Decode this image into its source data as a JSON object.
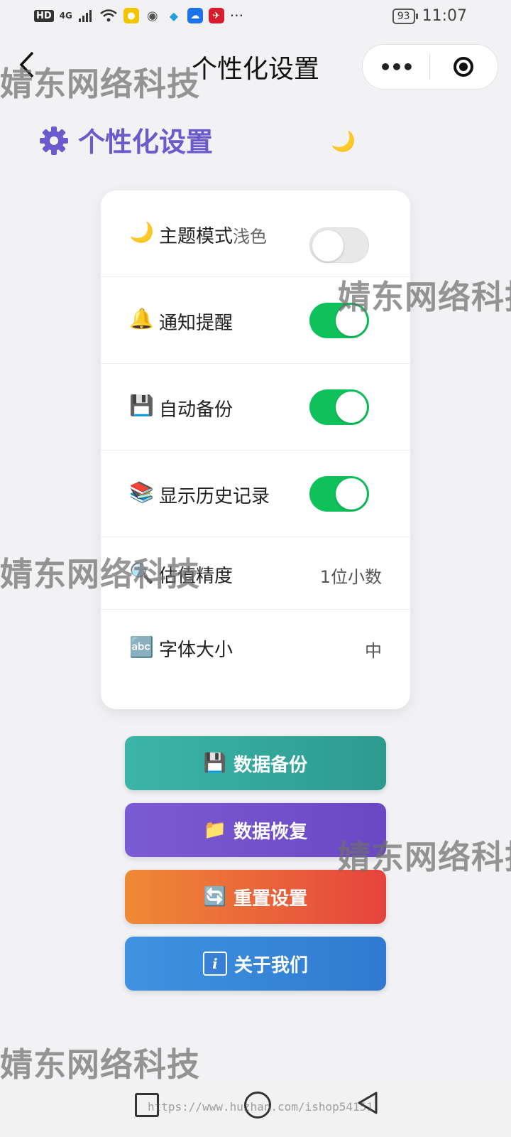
{
  "status_bar": {
    "hd_label": "HD",
    "network_label": "4G",
    "overflow_label": "···",
    "battery": "93",
    "time": "11:07"
  },
  "nav": {
    "back_glyph": "‹",
    "title": "个性化设置",
    "more_glyph": "•••"
  },
  "header": {
    "title": "个性化设置",
    "gear_color": "#6a5acd",
    "theme_toggle_icon": "🌙"
  },
  "settings": [
    {
      "icon": "🌙",
      "label": "主题模式",
      "sub": "浅色",
      "control": "switch",
      "on": false
    },
    {
      "icon": "🔔",
      "label": "通知提醒",
      "control": "switch",
      "on": true
    },
    {
      "icon": "💾",
      "label": "自动备份",
      "control": "switch",
      "on": true
    },
    {
      "icon": "📚",
      "label": "显示历史记录",
      "control": "switch",
      "on": true
    },
    {
      "icon": "🔍",
      "label": "估值精度",
      "control": "value",
      "value": "1位小数"
    },
    {
      "icon": "🔤",
      "label": "字体大小",
      "control": "value",
      "value": "中"
    }
  ],
  "actions": {
    "backup": {
      "icon": "💾",
      "label": "数据备份"
    },
    "restore": {
      "icon": "📁",
      "label": "数据恢复"
    },
    "reset": {
      "icon": "🔄",
      "label": "重置设置"
    },
    "about": {
      "icon": "i",
      "label": "关于我们"
    }
  },
  "watermark": {
    "text": "婧东网络科技",
    "url": "https://www.huzhan.com/ishop54151"
  },
  "colors": {
    "accent": "#6a5acd",
    "switch_on": "#0ec15a",
    "switch_off": "#e8e8e8"
  }
}
